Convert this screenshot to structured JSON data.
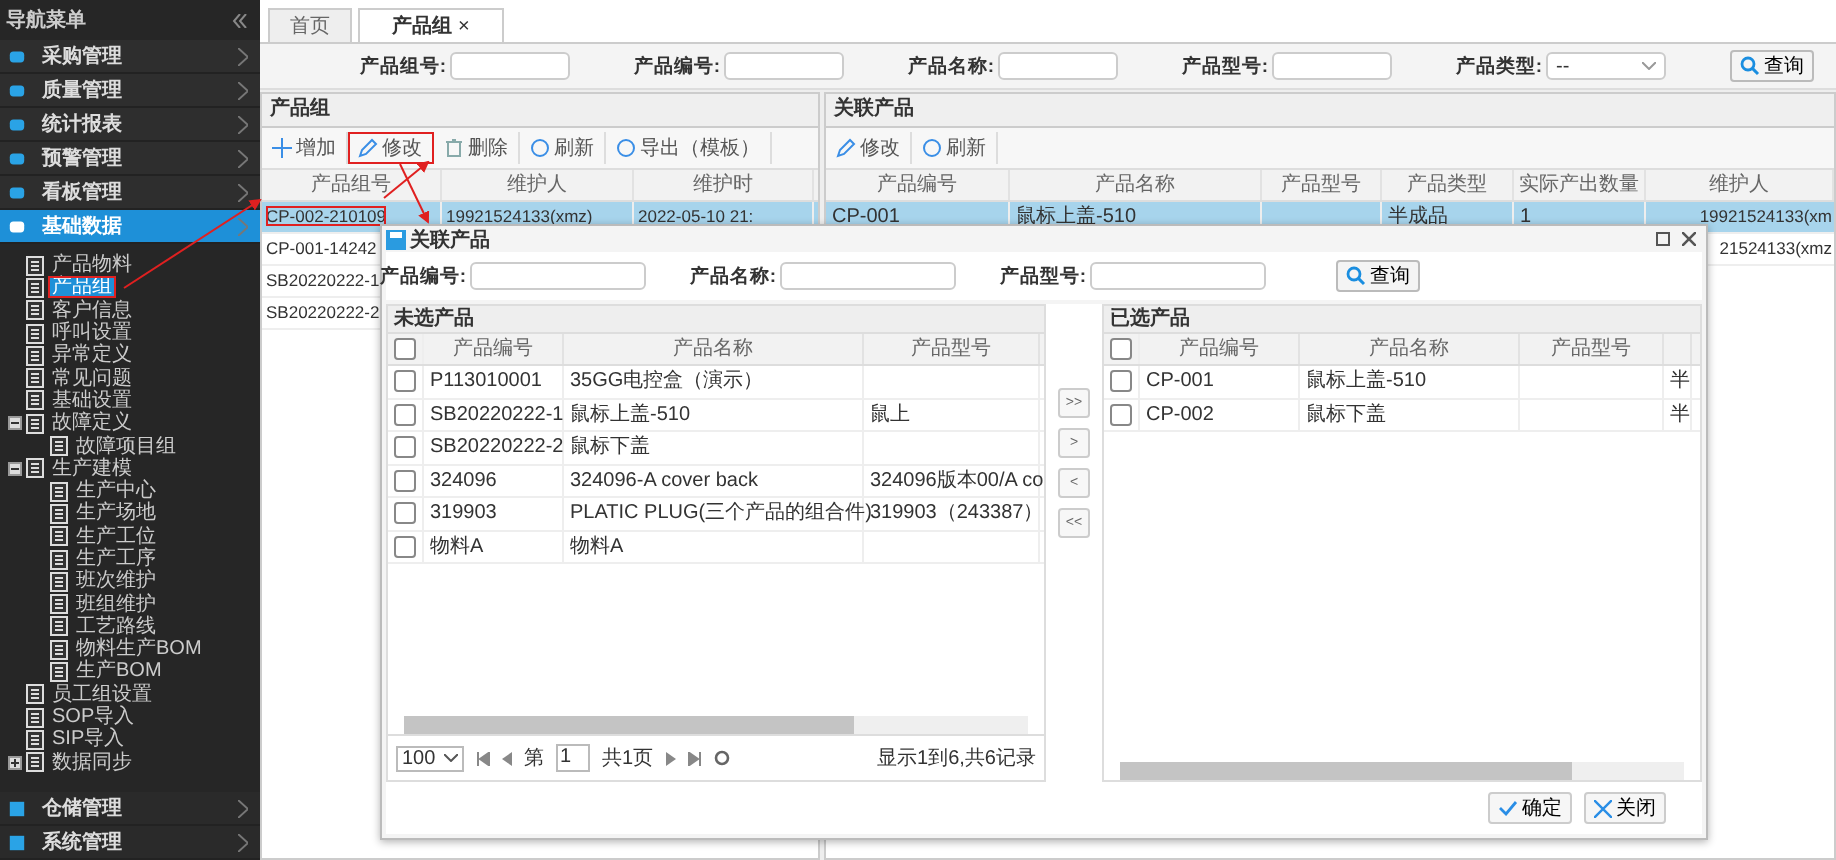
{
  "sidebar": {
    "title": "导航菜单",
    "menu_top": [
      {
        "label": "采购管理",
        "selected": false
      },
      {
        "label": "质量管理",
        "selected": false
      },
      {
        "label": "统计报表",
        "selected": false
      },
      {
        "label": "预警管理",
        "selected": false
      },
      {
        "label": "看板管理",
        "selected": false
      },
      {
        "label": "基础数据",
        "selected": true
      }
    ],
    "tree": [
      {
        "label": "产品物料",
        "selected": false
      },
      {
        "label": "产品组",
        "selected": true
      },
      {
        "label": "客户信息",
        "selected": false
      },
      {
        "label": "呼叫设置",
        "selected": false
      },
      {
        "label": "异常定义",
        "selected": false
      },
      {
        "label": "常见问题",
        "selected": false
      },
      {
        "label": "基础设置",
        "selected": false
      },
      {
        "label": "故障定义",
        "selected": false,
        "expanded": true,
        "children": [
          {
            "label": "故障项目组",
            "selected": false
          }
        ]
      },
      {
        "label": "生产建模",
        "selected": false,
        "expanded": true,
        "children": [
          {
            "label": "生产中心",
            "selected": false
          },
          {
            "label": "生产场地",
            "selected": false
          },
          {
            "label": "生产工位",
            "selected": false
          },
          {
            "label": "生产工序",
            "selected": false
          },
          {
            "label": "班次维护",
            "selected": false
          },
          {
            "label": "班组维护",
            "selected": false
          },
          {
            "label": "工艺路线",
            "selected": false
          },
          {
            "label": "物料生产BOM",
            "selected": false
          },
          {
            "label": "生产BOM",
            "selected": false
          }
        ]
      },
      {
        "label": "员工组设置",
        "selected": false
      },
      {
        "label": "SOP导入",
        "selected": false
      },
      {
        "label": "SIP导入",
        "selected": false
      },
      {
        "label": "数据同步",
        "selected": false,
        "expanded": false
      }
    ],
    "menu_bottom": [
      {
        "label": "仓储管理",
        "selected": false
      },
      {
        "label": "系统管理",
        "selected": false
      }
    ]
  },
  "tabs": [
    {
      "label": "首页",
      "selected": false
    },
    {
      "label": "产品组",
      "selected": true,
      "close": "×"
    }
  ],
  "filters": [
    {
      "label": "产品组号:",
      "kind": "text"
    },
    {
      "label": "产品编号:",
      "kind": "text"
    },
    {
      "label": "产品名称:",
      "kind": "text"
    },
    {
      "label": "产品型号:",
      "kind": "text"
    },
    {
      "label": "产品类型:",
      "kind": "select",
      "value": "--"
    }
  ],
  "search_button": "查询",
  "group_panel": {
    "title": "产品组",
    "toolbar": [
      "增加",
      "修改",
      "删除",
      "刷新",
      "导出（模板）"
    ],
    "columns": [
      "产品组号",
      "维护人",
      "维护时"
    ],
    "rows": [
      {
        "selected": true,
        "code": "CP-002-210109",
        "maintainer": "19921524133(xmz)",
        "time": "2022-05-10 21:"
      },
      {
        "selected": false,
        "code": "CP-001-14242"
      },
      {
        "selected": false,
        "code": "SB20220222-1"
      },
      {
        "selected": false,
        "code": "SB20220222-2"
      }
    ]
  },
  "linked_panel": {
    "title": "关联产品",
    "toolbar": [
      "修改",
      "刷新"
    ],
    "columns": [
      "产品编号",
      "产品名称",
      "产品型号",
      "产品类型",
      "实际产出数量",
      "维护人"
    ],
    "rows": [
      {
        "selected": true,
        "code": "CP-001",
        "name": "鼠标上盖-510",
        "type": "半成品",
        "quantity": "1",
        "maintainer": "19921524133(xm"
      },
      {
        "selected": false,
        "maintainer": "21524133(xmz"
      }
    ]
  },
  "dialog": {
    "title": "关联产品",
    "filters": [
      "产品编号:",
      "产品名称:",
      "产品型号:"
    ],
    "search_button": "查询",
    "unselected": {
      "title": "未选产品",
      "all_checked": false,
      "columns": [
        "产品编号",
        "产品名称",
        "产品型号"
      ],
      "rows": [
        {
          "checked": false,
          "code": "P113010001",
          "name": "35GG电控盒（演示）"
        },
        {
          "checked": false,
          "code": "SB20220222-1",
          "name": "鼠标上盖-510",
          "model": "鼠上"
        },
        {
          "checked": false,
          "code": "SB20220222-2",
          "name": "鼠标下盖"
        },
        {
          "checked": false,
          "code": "324096",
          "name": "324096-A cover back",
          "model": "324096版本00/A co"
        },
        {
          "checked": false,
          "code": "319903",
          "name": "PLATIC PLUG(三个产品的组合件)",
          "model": "319903（243387）"
        },
        {
          "checked": false,
          "code": "物料A",
          "name": "物料A"
        }
      ],
      "pagination": {
        "page_size": "100",
        "page_label": "第",
        "page": "1",
        "total_pages": "共1页",
        "summary": "显示1到6,共6记录"
      }
    },
    "transfer_buttons": [
      ">>",
      ">",
      "<",
      "<<"
    ],
    "selected": {
      "title": "已选产品",
      "all_checked": false,
      "columns": [
        "产品编号",
        "产品名称",
        "产品型号"
      ],
      "rows": [
        {
          "checked": false,
          "code": "CP-001",
          "name": "鼠标上盖-510",
          "type": "半"
        },
        {
          "checked": false,
          "code": "CP-002",
          "name": "鼠标下盖",
          "type": "半"
        }
      ]
    },
    "buttons": [
      {
        "label": "确定",
        "kind": "confirm"
      },
      {
        "label": "关闭",
        "kind": "close"
      }
    ]
  }
}
